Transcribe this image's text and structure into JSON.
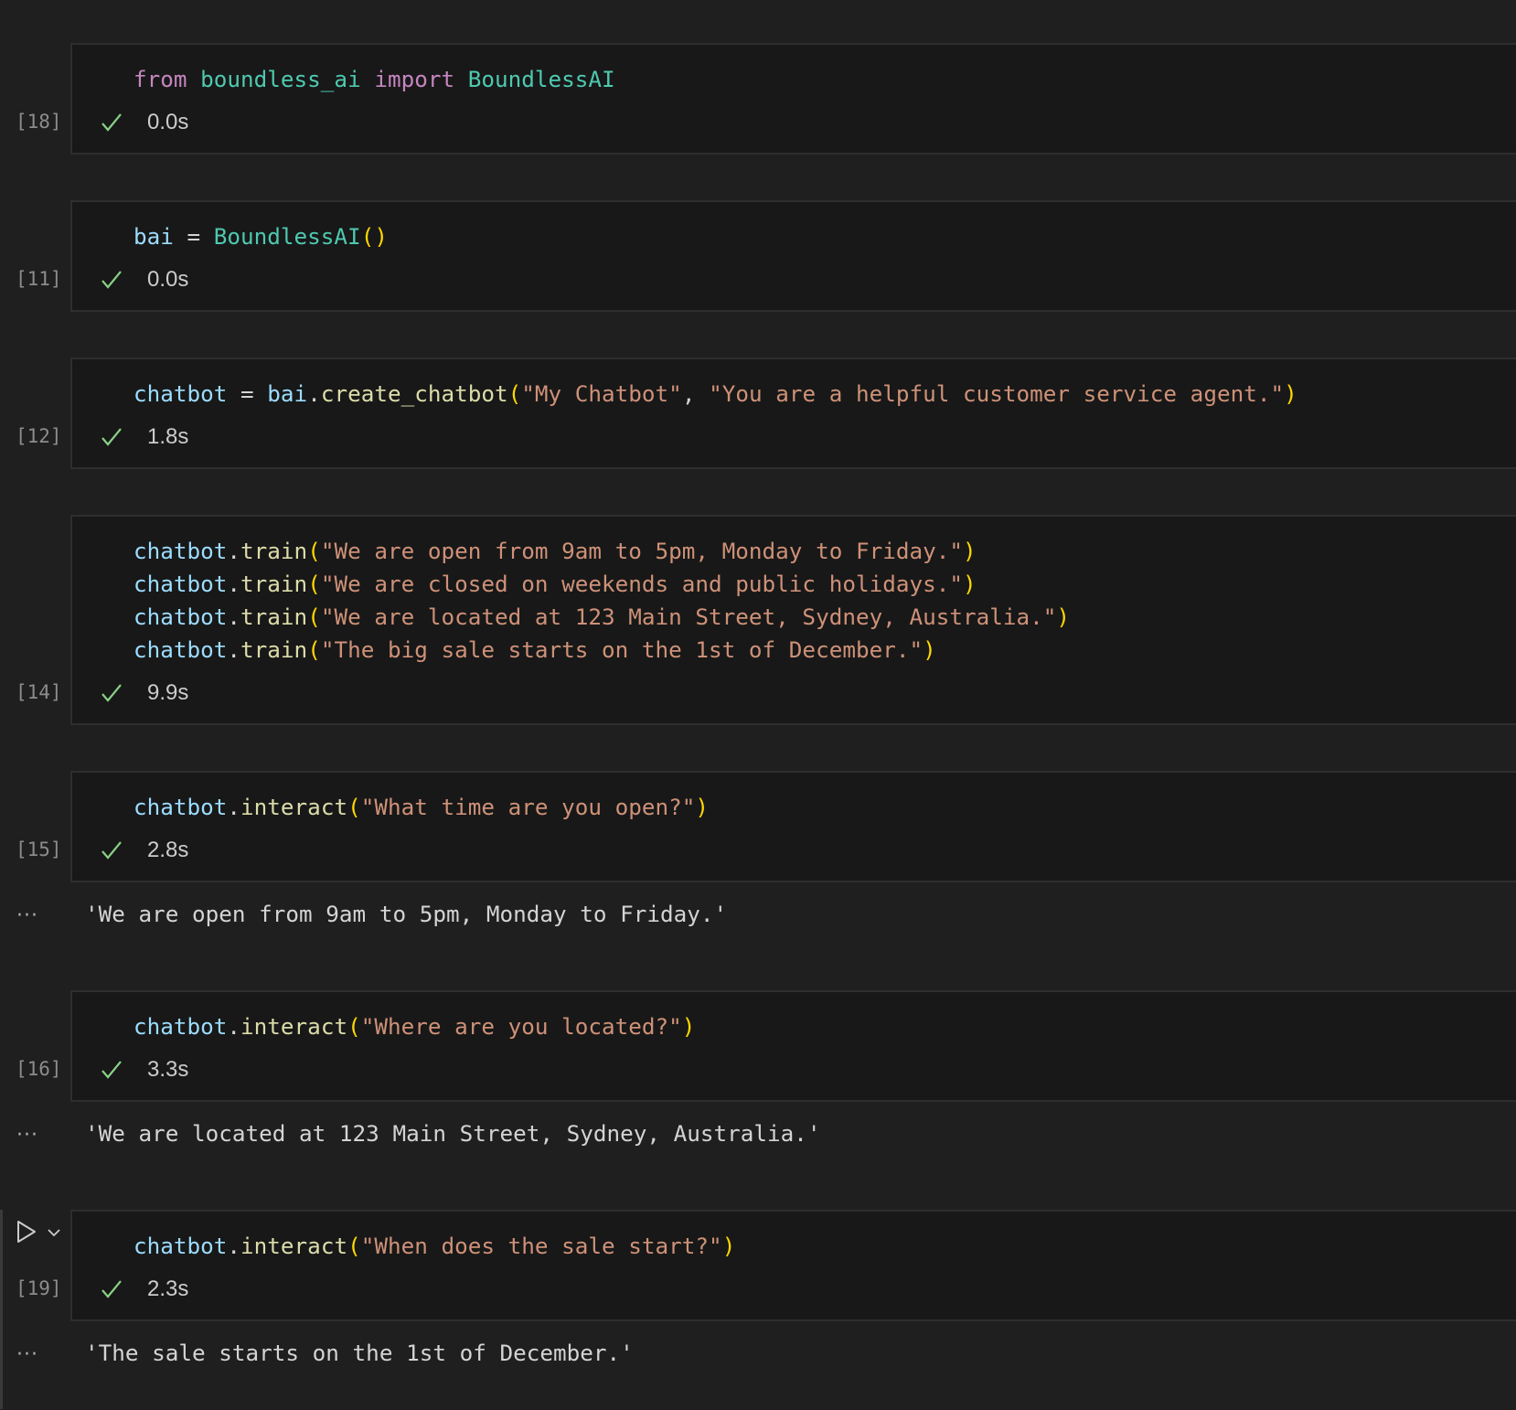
{
  "colors": {
    "background": "#1f1f1f",
    "cell_background": "#181818",
    "cell_border": "#2e2e2e",
    "success_check": "#89d185",
    "keyword": "#c586c0",
    "type": "#4ec9b0",
    "variable": "#9cdcfe",
    "function": "#dcdcaa",
    "string": "#ce9178",
    "bracket": "#ffd700"
  },
  "output_ellipsis": "···",
  "cells": [
    {
      "exec_count": "[18]",
      "status": "success",
      "duration": "0.0s",
      "lines": [
        [
          [
            "from",
            "k"
          ],
          [
            " ",
            "p"
          ],
          [
            "boundless_ai",
            "t"
          ],
          [
            " ",
            "p"
          ],
          [
            "import",
            "k"
          ],
          [
            " ",
            "p"
          ],
          [
            "BoundlessAI",
            "t"
          ]
        ]
      ]
    },
    {
      "exec_count": "[11]",
      "status": "success",
      "duration": "0.0s",
      "lines": [
        [
          [
            "bai",
            "v"
          ],
          [
            " = ",
            "p"
          ],
          [
            "BoundlessAI",
            "t"
          ],
          [
            "()",
            "b"
          ]
        ]
      ]
    },
    {
      "exec_count": "[12]",
      "status": "success",
      "duration": "1.8s",
      "lines": [
        [
          [
            "chatbot",
            "v"
          ],
          [
            " = ",
            "p"
          ],
          [
            "bai",
            "v"
          ],
          [
            ".",
            "p"
          ],
          [
            "create_chatbot",
            "f"
          ],
          [
            "(",
            "b"
          ],
          [
            "\"My Chatbot\"",
            "s"
          ],
          [
            ", ",
            "p"
          ],
          [
            "\"You are a helpful customer service agent.\"",
            "s"
          ],
          [
            ")",
            "b"
          ]
        ]
      ]
    },
    {
      "exec_count": "[14]",
      "status": "success",
      "duration": "9.9s",
      "lines": [
        [
          [
            "chatbot",
            "v"
          ],
          [
            ".",
            "p"
          ],
          [
            "train",
            "f"
          ],
          [
            "(",
            "b"
          ],
          [
            "\"We are open from 9am to 5pm, Monday to Friday.\"",
            "s"
          ],
          [
            ")",
            "b"
          ]
        ],
        [
          [
            "chatbot",
            "v"
          ],
          [
            ".",
            "p"
          ],
          [
            "train",
            "f"
          ],
          [
            "(",
            "b"
          ],
          [
            "\"We are closed on weekends and public holidays.\"",
            "s"
          ],
          [
            ")",
            "b"
          ]
        ],
        [
          [
            "chatbot",
            "v"
          ],
          [
            ".",
            "p"
          ],
          [
            "train",
            "f"
          ],
          [
            "(",
            "b"
          ],
          [
            "\"We are located at 123 Main Street, Sydney, Australia.\"",
            "s"
          ],
          [
            ")",
            "b"
          ]
        ],
        [
          [
            "chatbot",
            "v"
          ],
          [
            ".",
            "p"
          ],
          [
            "train",
            "f"
          ],
          [
            "(",
            "b"
          ],
          [
            "\"The big sale starts on the 1st of December.\"",
            "s"
          ],
          [
            ")",
            "b"
          ]
        ]
      ]
    },
    {
      "exec_count": "[15]",
      "status": "success",
      "duration": "2.8s",
      "lines": [
        [
          [
            "chatbot",
            "v"
          ],
          [
            ".",
            "p"
          ],
          [
            "interact",
            "f"
          ],
          [
            "(",
            "b"
          ],
          [
            "\"What time are you open?\"",
            "s"
          ],
          [
            ")",
            "b"
          ]
        ]
      ],
      "output": "'We are open from 9am to 5pm, Monday to Friday.'"
    },
    {
      "exec_count": "[16]",
      "status": "success",
      "duration": "3.3s",
      "lines": [
        [
          [
            "chatbot",
            "v"
          ],
          [
            ".",
            "p"
          ],
          [
            "interact",
            "f"
          ],
          [
            "(",
            "b"
          ],
          [
            "\"Where are you located?\"",
            "s"
          ],
          [
            ")",
            "b"
          ]
        ]
      ],
      "output": "'We are located at 123 Main Street, Sydney, Australia.'"
    },
    {
      "exec_count": "[19]",
      "status": "success",
      "duration": "2.3s",
      "focused": true,
      "lines": [
        [
          [
            "chatbot",
            "v"
          ],
          [
            ".",
            "p"
          ],
          [
            "interact",
            "f"
          ],
          [
            "(",
            "b"
          ],
          [
            "\"When does the sale start?\"",
            "s"
          ],
          [
            ")",
            "b"
          ]
        ]
      ],
      "output": "'The sale starts on the 1st of December.'"
    }
  ]
}
